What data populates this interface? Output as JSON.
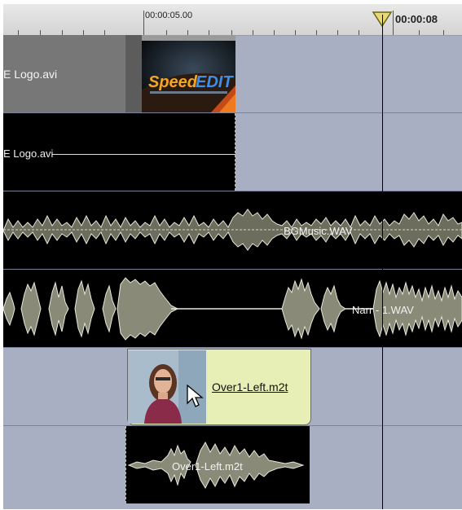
{
  "ruler": {
    "timecode_1": "00:00:05.00",
    "timecode_2": "00:00:08"
  },
  "tracks": {
    "video_1": {
      "clip_name": "E Logo.avi"
    },
    "audio_1": {
      "clip_name": "E Logo.avi"
    },
    "audio_2": {
      "clip_name": "BGMusic.WAV"
    },
    "audio_3": {
      "clip_name": "Narr - 1.WAV"
    },
    "video_2": {
      "clip_name": "Over1-Left.m2t"
    },
    "audio_4": {
      "clip_name": "Over1-Left.m2t"
    }
  },
  "thumbnail_logo": {
    "text": "SpeedEDIT"
  },
  "colors": {
    "track_empty": "#a9afc3",
    "audio_bg": "#000000",
    "waveform": "#d8d8c4",
    "overlay_clip": "#e8efb6"
  }
}
